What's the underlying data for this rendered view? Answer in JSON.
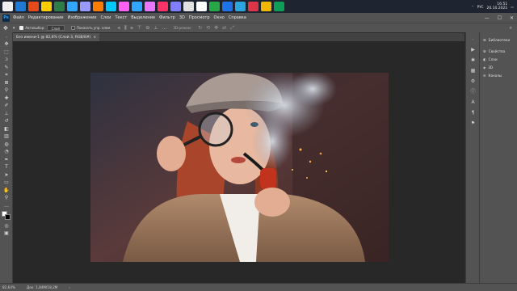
{
  "taskbar": {
    "apps": [
      {
        "name": "app-1",
        "color": "#f0f0f0"
      },
      {
        "name": "app-2",
        "color": "#1e7ad6"
      },
      {
        "name": "app-3",
        "color": "#e64a19"
      },
      {
        "name": "app-4",
        "color": "#ffcc00"
      },
      {
        "name": "app-5",
        "color": "#2d7d46"
      },
      {
        "name": "app-6",
        "color": "#31a8ff"
      },
      {
        "name": "app-7",
        "color": "#9999ff"
      },
      {
        "name": "app-8",
        "color": "#ff7c00"
      },
      {
        "name": "app-9",
        "color": "#00c8ff"
      },
      {
        "name": "app-10",
        "color": "#ff61f6"
      },
      {
        "name": "app-11",
        "color": "#31a8ff"
      },
      {
        "name": "app-12",
        "color": "#ea77ff"
      },
      {
        "name": "app-13",
        "color": "#ff3366"
      },
      {
        "name": "app-14",
        "color": "#7f7fff"
      },
      {
        "name": "app-15",
        "color": "#e0e0e0"
      },
      {
        "name": "app-16",
        "color": "#ffffff"
      },
      {
        "name": "app-17",
        "color": "#28a745"
      },
      {
        "name": "app-18",
        "color": "#1e73e8"
      },
      {
        "name": "app-19",
        "color": "#2ca5e0"
      },
      {
        "name": "app-20",
        "color": "#dc3545"
      },
      {
        "name": "app-21",
        "color": "#f2b705"
      },
      {
        "name": "app-22",
        "color": "#0f9d58"
      }
    ],
    "lang": "РУС",
    "time": "16:51",
    "date": "20.10.2021"
  },
  "app": {
    "logo": "Ps",
    "menu": [
      "Файл",
      "Редактирование",
      "Изображение",
      "Слои",
      "Текст",
      "Выделение",
      "Фильтр",
      "3D",
      "Просмотр",
      "Окно",
      "Справка"
    ],
    "window_controls": [
      "—",
      "☐",
      "✕"
    ]
  },
  "options": {
    "autoselect_label": "Автовыбор:",
    "autoselect_value": "Слой",
    "show_controls_label": "Показать упр. элем.",
    "mode_3d_label": "3D-режим:"
  },
  "document": {
    "tab_title": "Без имени-1 @ 82,6% (Слой 3, RGB/8#)",
    "close": "×"
  },
  "panels": [
    {
      "icon": "☰",
      "label": "Библиотеки"
    },
    {
      "icon": "⚙",
      "label": "Свойства"
    },
    {
      "icon": "◐",
      "label": "Слои"
    },
    {
      "icon": "◈",
      "label": "3D"
    },
    {
      "icon": "≡",
      "label": "Каналы"
    }
  ],
  "status": {
    "zoom": "82,64%",
    "doc_size": "Док: 1,84М/18,2М"
  },
  "colors": {
    "accent": "#31a8ff"
  }
}
